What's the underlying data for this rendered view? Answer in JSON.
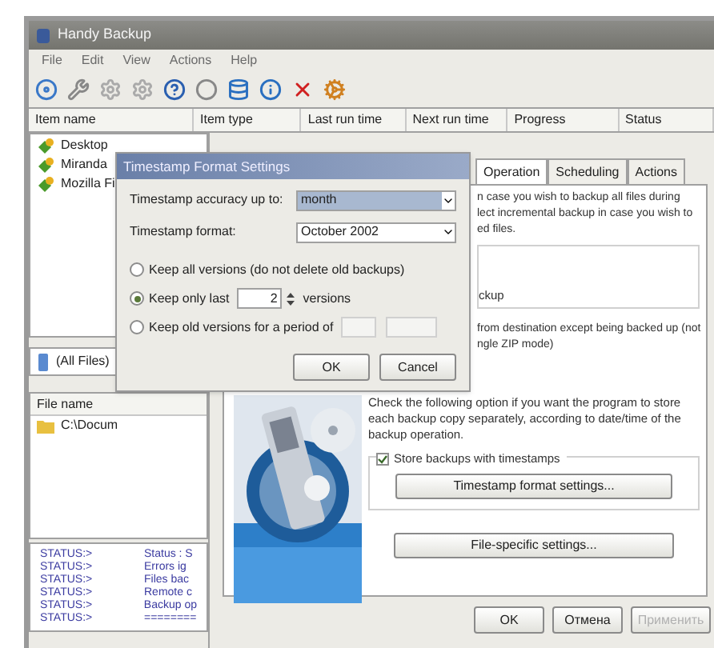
{
  "window": {
    "title": "Handy Backup"
  },
  "menu": [
    "File",
    "Edit",
    "View",
    "Actions",
    "Help"
  ],
  "columns": [
    "Item name",
    "Item type",
    "Last run time",
    "Next run time",
    "Progress",
    "Status"
  ],
  "items": [
    "Desktop",
    "Miranda",
    "Mozilla Fi"
  ],
  "filter": "(All Files)",
  "file_list": {
    "column": "File name",
    "rows": [
      "C:\\Docum"
    ]
  },
  "log": [
    {
      "label": "STATUS:>",
      "message": "Status : S"
    },
    {
      "label": "STATUS:>",
      "message": "Errors ig"
    },
    {
      "label": "STATUS:>",
      "message": "Files bac"
    },
    {
      "label": "STATUS:>",
      "message": "Remote c"
    },
    {
      "label": "STATUS:>",
      "message": "Backup op"
    },
    {
      "label": "STATUS:>",
      "message": "========"
    }
  ],
  "properties": {
    "tabs": [
      {
        "label": "Operation",
        "selected": true
      },
      {
        "label": "Scheduling",
        "selected": false
      },
      {
        "label": "Actions",
        "selected": false
      }
    ],
    "intro": [
      "n case you wish to backup all files during",
      "lect incremental backup in case you wish to",
      "ed files."
    ],
    "group_text": "ckup",
    "note": [
      "from destination except being backed up (not",
      "ngle ZIP mode)"
    ],
    "timestamp_text": "Check the following option if you want the program to store each backup copy separately, according to date/time of the backup operation.",
    "timestamps": {
      "label": "Store backups with timestamps",
      "checked": true
    },
    "timestamp_button": "Timestamp format settings...",
    "file_button": "File-specific settings...",
    "buttons": [
      {
        "label": "OK",
        "disabled": false
      },
      {
        "label": "Отмена",
        "disabled": false
      },
      {
        "label": "Применить",
        "disabled": true
      }
    ]
  },
  "dialog": {
    "title": "Timestamp Format Settings",
    "accuracy_label": "Timestamp accuracy up to:",
    "accuracy": "month",
    "format_label": "Timestamp format:",
    "format": "October 2002",
    "options": [
      {
        "kind": "plain",
        "label": "Keep all versions (do not delete old backups)",
        "selected": false
      },
      {
        "kind": "count",
        "label": "Keep only last",
        "selected": true,
        "count": "2",
        "suffix": "versions"
      },
      {
        "kind": "period",
        "label": "Keep old versions for a period of",
        "selected": false
      }
    ],
    "buttons": [
      "OK",
      "Cancel"
    ]
  }
}
